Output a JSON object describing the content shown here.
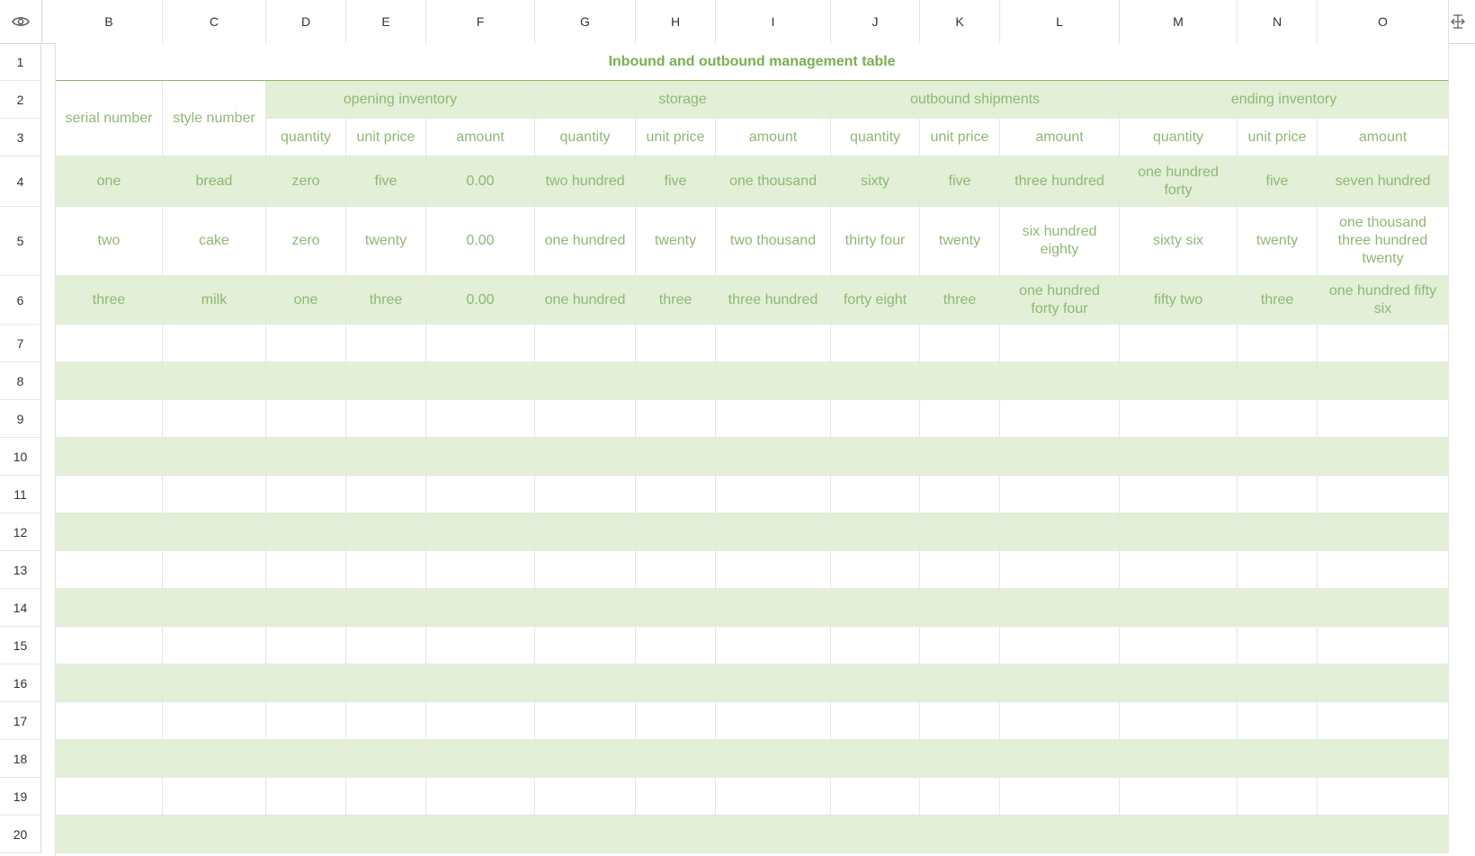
{
  "columns": [
    "B",
    "C",
    "D",
    "E",
    "F",
    "G",
    "H",
    "I",
    "J",
    "K",
    "L",
    "M",
    "N",
    "O"
  ],
  "rows": [
    "1",
    "2",
    "3",
    "4",
    "5",
    "6",
    "7",
    "8",
    "9",
    "10",
    "11",
    "12",
    "13",
    "14",
    "15",
    "16",
    "17",
    "18",
    "19",
    "20"
  ],
  "title": "Inbound and outbound management table",
  "headers": {
    "serial_number": "serial number",
    "style_number": "style number",
    "groups": [
      "opening inventory",
      "storage",
      "outbound shipments",
      "ending inventory"
    ],
    "sub": [
      "quantity",
      "unit price",
      "amount",
      "quantity",
      "unit price",
      "amount",
      "quantity",
      "unit price",
      "amount",
      "quantity",
      "unit price",
      "amount"
    ]
  },
  "data_rows": [
    [
      "one",
      "bread",
      "zero",
      "five",
      "0.00",
      "two hundred",
      "five",
      "one thousand",
      "sixty",
      "five",
      "three hundred",
      "one hundred forty",
      "five",
      "seven hundred"
    ],
    [
      "two",
      "cake",
      "zero",
      "twenty",
      "0.00",
      "one hundred",
      "twenty",
      "two thousand",
      "thirty four",
      "twenty",
      "six hundred eighty",
      "sixty six",
      "twenty",
      "one thousand three hundred twenty"
    ],
    [
      "three",
      "milk",
      "one",
      "three",
      "0.00",
      "one hundred",
      "three",
      "three hundred",
      "forty eight",
      "three",
      "one hundred forty four",
      "fifty two",
      "three",
      "one hundred fifty six"
    ]
  ],
  "icons": {
    "corner": "eye-icon",
    "end": "column-resize-icon"
  },
  "colors": {
    "accent": "#78b04e",
    "band": "#e3efd7",
    "text": "#8fb774"
  }
}
